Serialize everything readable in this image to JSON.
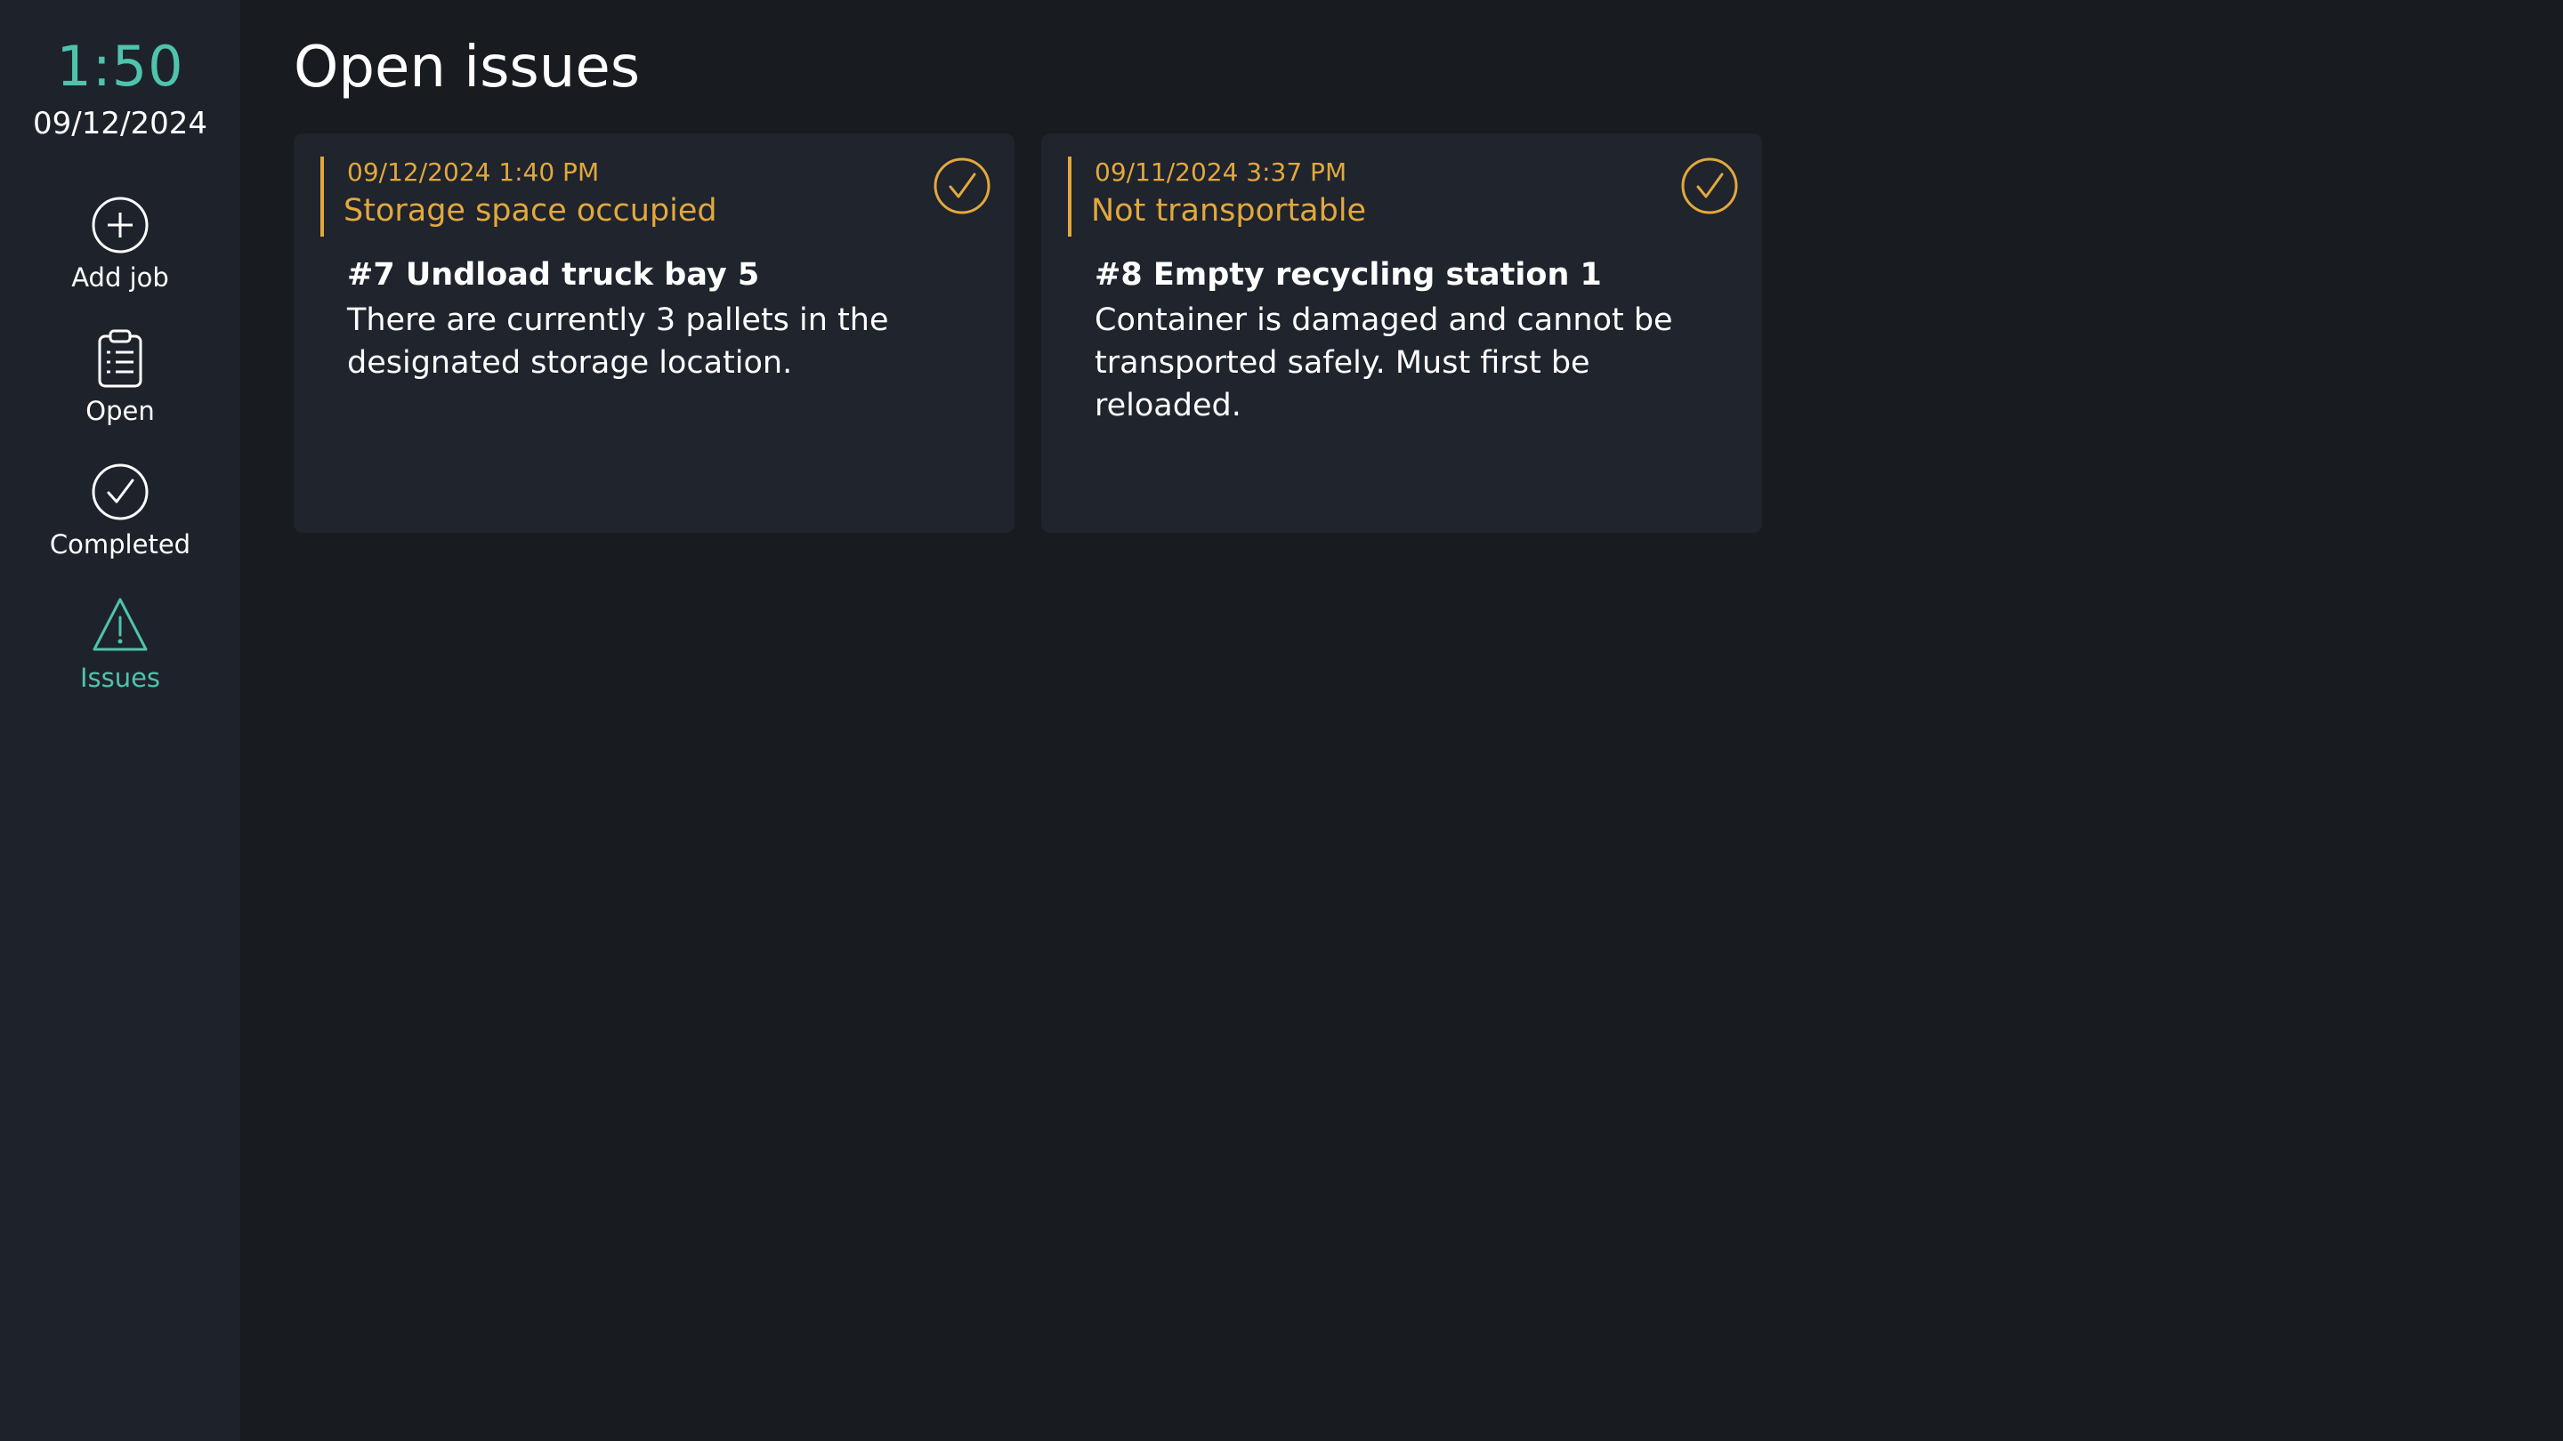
{
  "sidebar": {
    "clock_time": "1:50",
    "clock_date": "09/12/2024",
    "items": [
      {
        "label": "Add job",
        "icon": "plus-circle-icon",
        "active": false
      },
      {
        "label": "Open",
        "icon": "clipboard-list-icon",
        "active": false
      },
      {
        "label": "Completed",
        "icon": "check-circle-icon",
        "active": false
      },
      {
        "label": "Issues",
        "icon": "warning-triangle-icon",
        "active": true
      }
    ]
  },
  "main": {
    "title": "Open issues",
    "issues": [
      {
        "timestamp": "09/12/2024 1:40 PM",
        "reason": "Storage space occupied",
        "job_title": "#7 Undload truck bay 5",
        "description": "There are currently 3 pallets in the designated storage location.",
        "resolve_icon": "check-circle-icon"
      },
      {
        "timestamp": "09/11/2024 3:37 PM",
        "reason": "Not transportable",
        "job_title": "#8 Empty recycling station 1",
        "description": "Container is damaged and cannot be transported safely. Must first be reloaded.",
        "resolve_icon": "check-circle-icon"
      }
    ]
  },
  "colors": {
    "accent": "#4fc3ad",
    "warning": "#e3a83c",
    "background": "#181b20",
    "sidebar": "#1e232b",
    "card": "#1f242d"
  }
}
